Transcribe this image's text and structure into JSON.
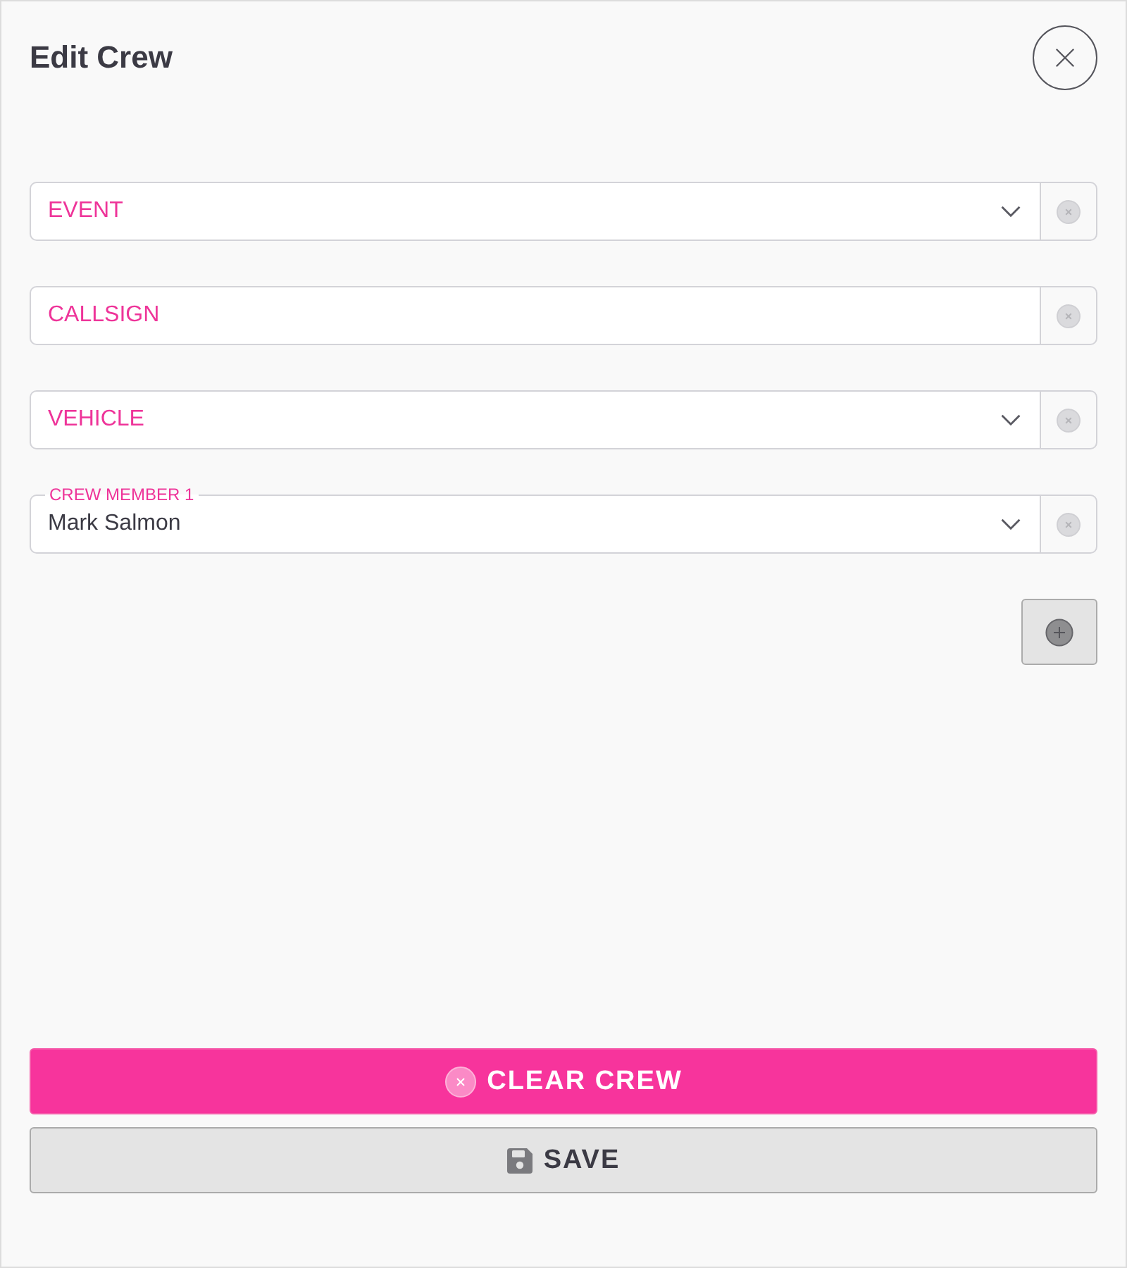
{
  "dialog": {
    "title": "Edit Crew"
  },
  "fields": [
    {
      "kind": "select",
      "placeholder": "EVENT"
    },
    {
      "kind": "text",
      "placeholder": "CALLSIGN"
    },
    {
      "kind": "select",
      "placeholder": "VEHICLE"
    },
    {
      "kind": "select",
      "label": "CREW MEMBER 1",
      "value": "Mark Salmon"
    }
  ],
  "buttons": [
    {
      "kind": "danger",
      "label": "CLEAR CREW"
    },
    {
      "kind": "default",
      "label": "SAVE"
    }
  ]
}
